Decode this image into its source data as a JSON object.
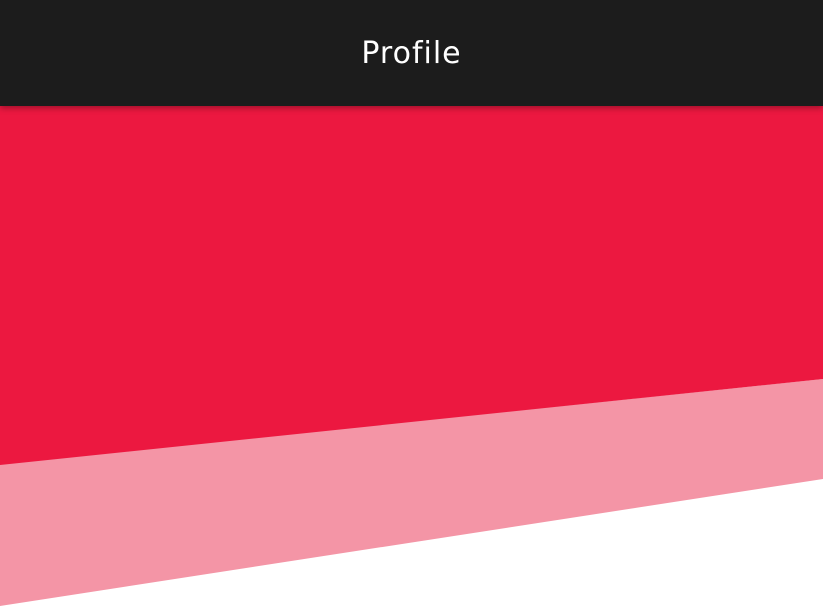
{
  "app_bar": {
    "title": "Profile"
  },
  "colors": {
    "app_bar_background": "#1c1c1c",
    "app_bar_text": "#ffffff",
    "hero_primary": "#ec1840",
    "hero_secondary": "#f495a6",
    "page_background": "#ffffff"
  }
}
